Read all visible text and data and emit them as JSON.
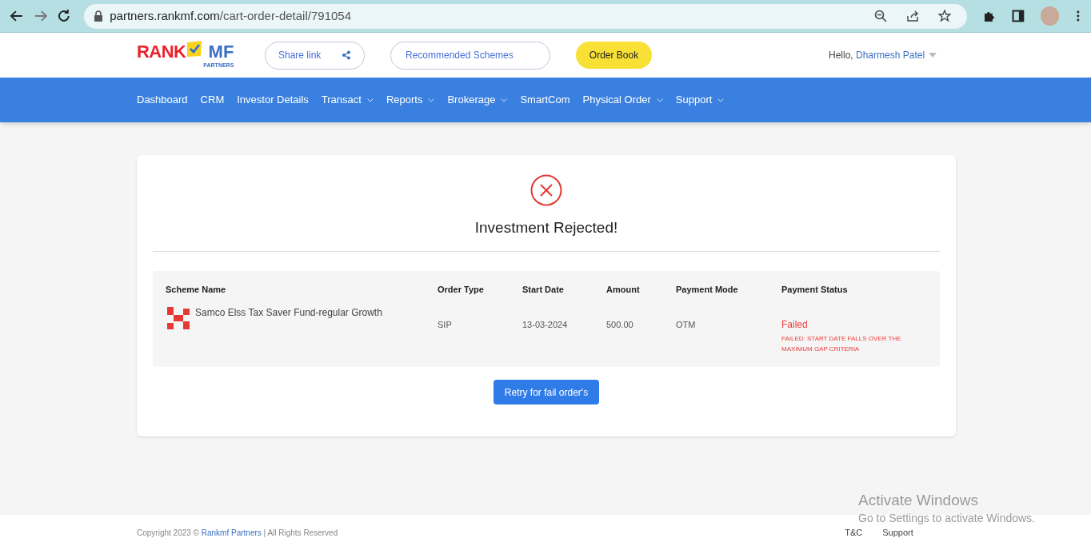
{
  "browser": {
    "url_host": "partners.rankmf.com",
    "url_path": "/cart-order-detail/791054"
  },
  "header": {
    "logo": {
      "word1": "RANK",
      "word2": "MF",
      "tagline": "PARTNERS"
    },
    "share_button": "Share link",
    "recommended_button": "Recommended Schemes",
    "order_book_button": "Order Book",
    "greeting": "Hello,",
    "user_name": "Dharmesh Patel"
  },
  "nav": [
    {
      "label": "Dashboard",
      "has_dropdown": false
    },
    {
      "label": "CRM",
      "has_dropdown": false
    },
    {
      "label": "Investor Details",
      "has_dropdown": false
    },
    {
      "label": "Transact",
      "has_dropdown": true
    },
    {
      "label": "Reports",
      "has_dropdown": true
    },
    {
      "label": "Brokerage",
      "has_dropdown": true
    },
    {
      "label": "SmartCom",
      "has_dropdown": false
    },
    {
      "label": "Physical Order",
      "has_dropdown": true
    },
    {
      "label": "Support",
      "has_dropdown": true
    }
  ],
  "result": {
    "title": "Investment Rejected!"
  },
  "table": {
    "columns": [
      "Scheme Name",
      "Order Type",
      "Start Date",
      "Amount",
      "Payment Mode",
      "Payment Status"
    ],
    "rows": [
      {
        "scheme": "Samco Elss Tax Saver Fund-regular Growth",
        "order_type": "SIP",
        "start_date": "13-03-2024",
        "amount": "500.00",
        "payment_mode": "OTM",
        "status": "Failed",
        "status_detail": "FAILED: START DATE FALLS OVER THE MAXIMUM GAP CRITERIA"
      }
    ]
  },
  "retry_button": "Retry for fail order's",
  "footer": {
    "copyright_prefix": "Copyright 2023 ©",
    "copyright_link": "Rankmf Partners",
    "copyright_suffix": "| All Rights Reserved",
    "links": [
      "T&C",
      "Support"
    ]
  },
  "os_overlay": {
    "title": "Activate Windows",
    "subtitle": "Go to Settings to activate Windows."
  }
}
